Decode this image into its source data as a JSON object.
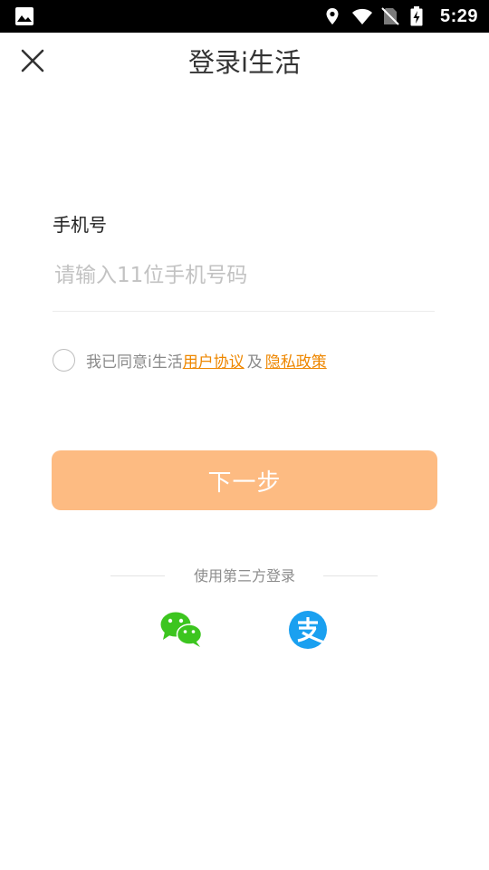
{
  "status_bar": {
    "time": "5:29",
    "icons": [
      "image-icon",
      "location-icon",
      "wifi-icon",
      "no-sim-icon",
      "battery-charging-icon"
    ]
  },
  "header": {
    "title": "登录i生活",
    "close_icon": "close-icon"
  },
  "form": {
    "phone_label": "手机号",
    "phone_placeholder": "请输入11位手机号码",
    "phone_value": ""
  },
  "agreement": {
    "checked": false,
    "prefix": "我已同意i生活",
    "user_agreement": "用户协议",
    "and": "及",
    "privacy_policy": "隐私政策"
  },
  "next_button": {
    "label": "下一步"
  },
  "third_party": {
    "label": "使用第三方登录",
    "providers": [
      "wechat-icon",
      "alipay-icon"
    ]
  },
  "colors": {
    "accent": "#ee8700",
    "button": "#fdbb82",
    "wechat": "#3cc51f",
    "alipay": "#1aa0f0"
  }
}
